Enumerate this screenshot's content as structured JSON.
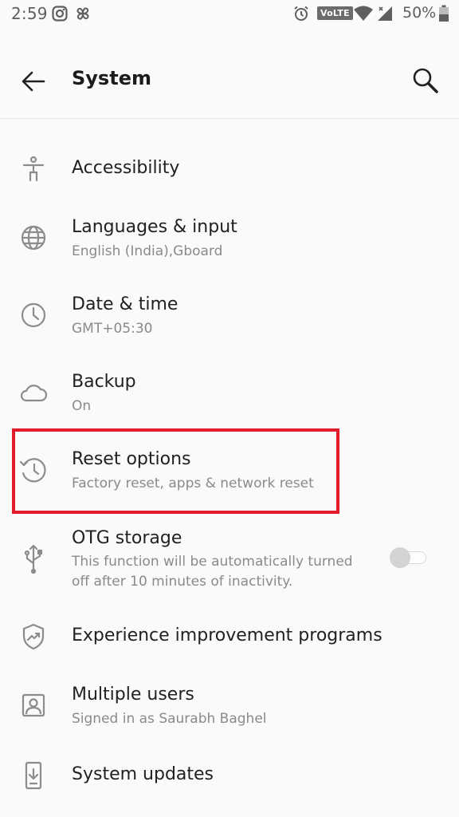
{
  "status_bar": {
    "time": "2:59",
    "network_badge": "VoLTE",
    "battery": "50%",
    "icons": [
      "instagram-icon",
      "pinwheel-icon",
      "alarm-icon",
      "wifi-icon",
      "signal-icon",
      "battery-icon"
    ]
  },
  "toolbar": {
    "title": "System",
    "back_icon": "arrow-left-icon",
    "search_icon": "search-icon"
  },
  "items": [
    {
      "title": "Accessibility",
      "subtitle": "",
      "icon": "accessibility-icon"
    },
    {
      "title": "Languages & input",
      "subtitle": "English (India),Gboard",
      "icon": "globe-icon"
    },
    {
      "title": "Date & time",
      "subtitle": "GMT+05:30",
      "icon": "clock-icon"
    },
    {
      "title": "Backup",
      "subtitle": "On",
      "icon": "cloud-icon"
    },
    {
      "title": "Reset options",
      "subtitle": "Factory reset, apps & network reset",
      "icon": "history-icon"
    },
    {
      "title": "OTG storage",
      "subtitle": "This function will be automatically turned off after 10 minutes of inactivity.",
      "icon": "usb-icon",
      "toggle_on": false
    },
    {
      "title": "Experience improvement programs",
      "subtitle": "",
      "icon": "shield-trend-icon"
    },
    {
      "title": "Multiple users",
      "subtitle": "Signed in as Saurabh Baghel",
      "icon": "user-icon"
    },
    {
      "title": "System updates",
      "subtitle": "",
      "icon": "system-update-icon"
    }
  ],
  "highlight_color": "#e21b2b"
}
